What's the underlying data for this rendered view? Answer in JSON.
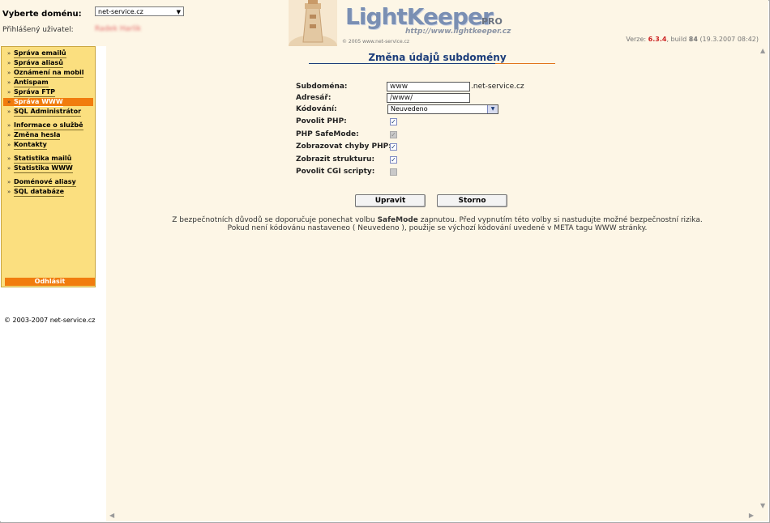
{
  "header": {
    "domain_label": "Vyberte doménu:",
    "domain_value": "net-service.cz",
    "user_label": "Přihlášený uživatel:",
    "user_name": "Radek Harlik",
    "logo_text": "LightKeeper",
    "logo_pro": "PRO",
    "logo_url": "http://www.lightkeeper.cz",
    "logo_copy": "© 2005 www.net-service.cz",
    "version_prefix": "Verze:",
    "version_number": "6.3.4",
    "build_prefix": ", build",
    "build_number": "84",
    "build_date": "(19.3.2007 08:42)"
  },
  "menu": {
    "items": [
      {
        "label": "Správa emailů"
      },
      {
        "label": "Správa aliasů"
      },
      {
        "label": "Oznámení na mobil"
      },
      {
        "label": "Antispam"
      },
      {
        "label": "Správa FTP"
      },
      {
        "label": "Správa WWW",
        "active": true
      },
      {
        "label": "SQL Administrátor"
      },
      {
        "label": "Informace o službě"
      },
      {
        "label": "Změna hesla"
      },
      {
        "label": "Kontakty"
      },
      {
        "label": "Statistika mailů"
      },
      {
        "label": "Statistika WWW"
      },
      {
        "label": "Doménové aliasy"
      },
      {
        "label": "SQL databáze"
      }
    ],
    "logout": "Odhlásit",
    "copyright": "© 2003-2007 net-service.cz"
  },
  "form": {
    "title": "Změna údajů subdomény",
    "subdomain_label": "Subdoména:",
    "subdomain_value": "www",
    "subdomain_suffix": ".net-service.cz",
    "dir_label": "Adresář:",
    "dir_value": "/www/",
    "encoding_label": "Kódování:",
    "encoding_value": "Neuvedeno",
    "php_label": "Povolit PHP:",
    "safemode_label": "PHP SafeMode:",
    "errors_label": "Zobrazovat chyby PHP:",
    "structure_label": "Zobrazit strukturu:",
    "cgi_label": "Povolit CGI scripty:",
    "submit": "Upravit",
    "cancel": "Storno",
    "note1_a": "Z bezpečnotních důvodů se doporučuje ponechat volbu ",
    "note1_b": "SafeMode",
    "note1_c": " zapnutou. Před vypnutím této volby si nastudujte možné bezpečnostní rizika.",
    "note2": "Pokud není kódovánu nastaveneo ( Neuvedeno ), použije se výchozí kódování uvedené v META tagu WWW stránky."
  },
  "colors": {
    "accent": "#f17c0e",
    "menu_bg": "#fbdf7f",
    "title": "#1c3d7a",
    "content_bg": "#fdf6e6"
  }
}
